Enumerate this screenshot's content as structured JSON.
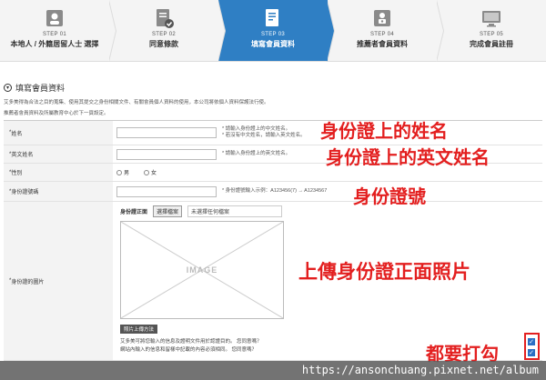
{
  "steps": [
    {
      "num": "STEP 01",
      "label": "本地人 / 外籍居留人士 選擇",
      "icon": "person-icon",
      "active": false
    },
    {
      "num": "STEP 02",
      "label": "同意條款",
      "icon": "document-check-icon",
      "active": false
    },
    {
      "num": "STEP 03",
      "label": "填寫會員資料",
      "icon": "form-edit-icon",
      "active": true
    },
    {
      "num": "STEP 04",
      "label": "推薦者會員資料",
      "icon": "referrer-icon",
      "active": false
    },
    {
      "num": "STEP 05",
      "label": "完成會員註冊",
      "icon": "monitor-icon",
      "active": false
    }
  ],
  "section": {
    "title": "填寫會員資料",
    "notes": [
      "艾多美得為合法之目的蒐集、使用其提交之身份相關文件、有關會員個人資料的使用，本公司將依個人資料保護法行使。",
      "推薦者會員資料及所屬教育中心於下一頁設定。"
    ]
  },
  "form": {
    "name": {
      "label": "姓名",
      "hint1": "請輸入身份證上的中文姓名。",
      "hint2": "若沒有中文姓名，請輸入英文姓名。"
    },
    "english_name": {
      "label": "英文姓名",
      "hint": "請輸入身份證上的英文姓名。"
    },
    "gender": {
      "label": "性別",
      "male": "男",
      "female": "女"
    },
    "id_number": {
      "label": "身份證號碼",
      "hint": "身份證號輸入示例：A123456(7) → A1234567"
    },
    "id_photo": {
      "label": "身份證的圖片",
      "front_label": "身份證正面",
      "choose_button": "選擇檔案",
      "no_file": "未選擇任何檔案",
      "placeholder": "IMAGE",
      "method_button": "照片上傳方法",
      "agree1": "艾多美可將您輸入的信息及證明文件用於認證目的。 您同意嗎？",
      "agree2": "網站內輸入的信息和留樣中記載的內容必須相同。 您同意嗎？"
    }
  },
  "annotations": {
    "name": "身份證上的姓名",
    "english_name": "身份證上的英文姓名",
    "id_number": "身份證號",
    "photo": "上傳身份證正面照片",
    "check": "都要打勾"
  },
  "watermark": "https://ansonchuang.pixnet.net/album",
  "colors": {
    "active_step": "#2f7fc4",
    "annotation": "#e31f1f"
  }
}
